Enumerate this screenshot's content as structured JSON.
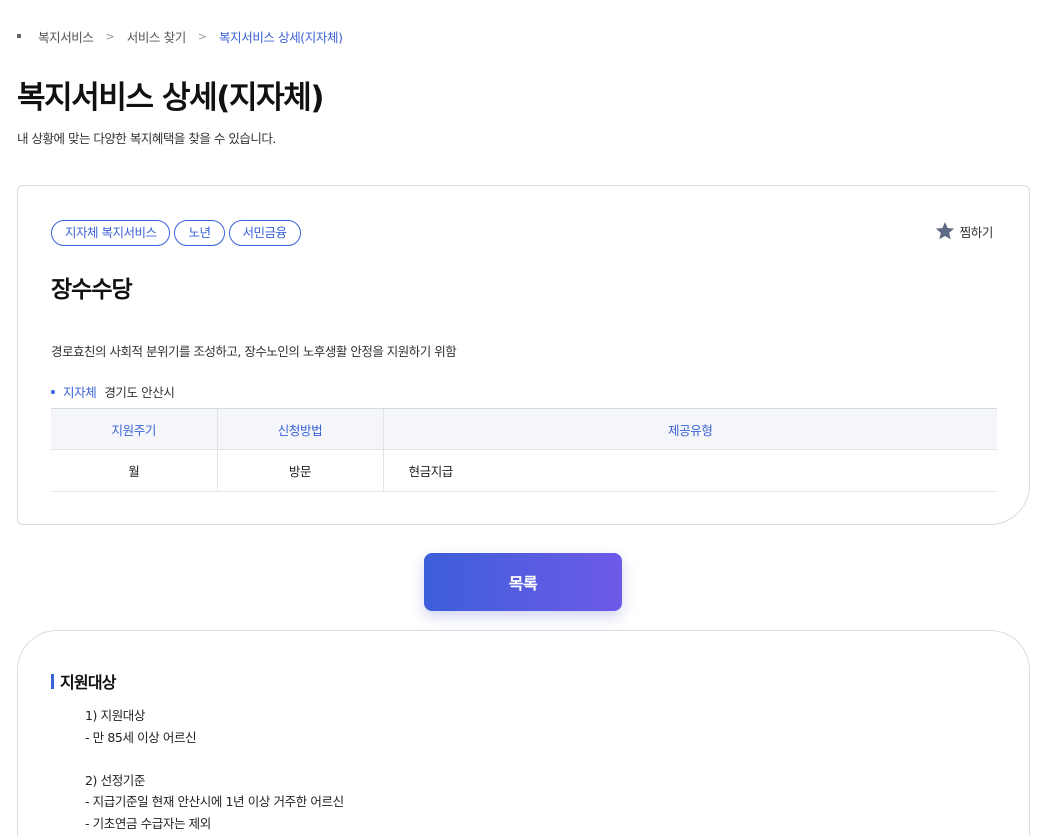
{
  "breadcrumb": {
    "items": [
      "복지서비스",
      "서비스 찾기",
      "복지서비스 상세(지자체)"
    ],
    "separator": ">"
  },
  "page": {
    "title": "복지서비스 상세(지자체)",
    "subtitle": "내 상황에 맞는 다양한 복지혜택을 찾을 수 있습니다."
  },
  "card": {
    "tags": [
      "지자체 복지서비스",
      "노년",
      "서민금융"
    ],
    "favorite_label": "찜하기",
    "favorite_icon": "star-icon",
    "service_name": "장수수당",
    "description": "경로효친의 사회적 분위기를 조성하고, 장수노인의 노후생활 안정을 지원하기 위함",
    "region_label": "지자체",
    "region_value": "경기도 안산시",
    "table": {
      "headers": [
        "지원주기",
        "신청방법",
        "제공유형"
      ],
      "row": [
        "월",
        "방문",
        "현금지급"
      ]
    }
  },
  "list_button": "목록",
  "section": {
    "title": "지원대상",
    "lines": [
      "1) 지원대상",
      "- 만 85세 이상 어르신",
      "",
      "2) 선정기준",
      "- 지급기준일 현재 안산시에 1년 이상 거주한 어르신",
      "- 기초연금 수급자는 제외"
    ]
  },
  "colors": {
    "accent": "#3b63d6",
    "button_gradient_start": "#3d5fd9",
    "button_gradient_end": "#6d5ae8",
    "table_header_bg": "#f5f6f9",
    "star": "#5f6a85"
  }
}
